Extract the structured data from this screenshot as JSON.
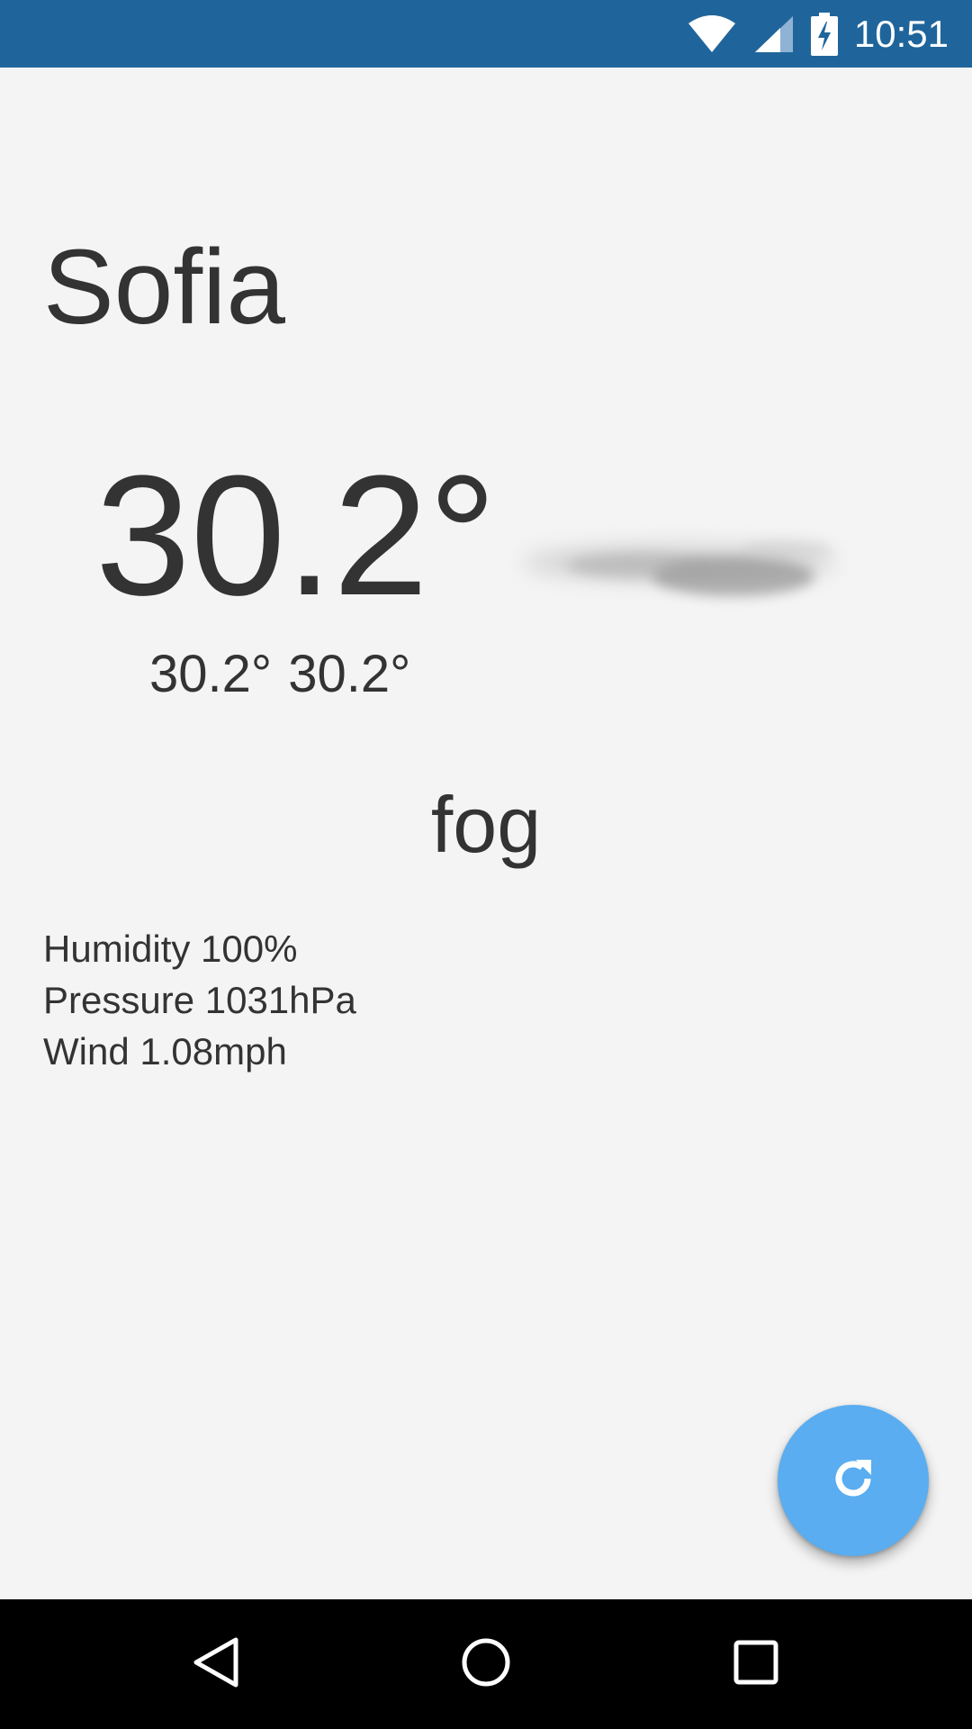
{
  "status_bar": {
    "time": "10:51",
    "background_color": "#1f659b",
    "icons": [
      "wifi-icon",
      "cell-signal-icon",
      "battery-charging-icon"
    ]
  },
  "weather": {
    "city": "Sofia",
    "temperature": "30.2°",
    "min_max": "30.2° 30.2°",
    "description": "fog",
    "icon": "fog-icon",
    "details": {
      "humidity": "Humidity 100%",
      "pressure": "Pressure 1031hPa",
      "wind": "Wind 1.08mph"
    }
  },
  "fab": {
    "icon": "refresh-icon",
    "color": "#59adf0"
  },
  "nav_bar": {
    "icons": [
      "back-icon",
      "home-icon",
      "recents-icon"
    ]
  }
}
